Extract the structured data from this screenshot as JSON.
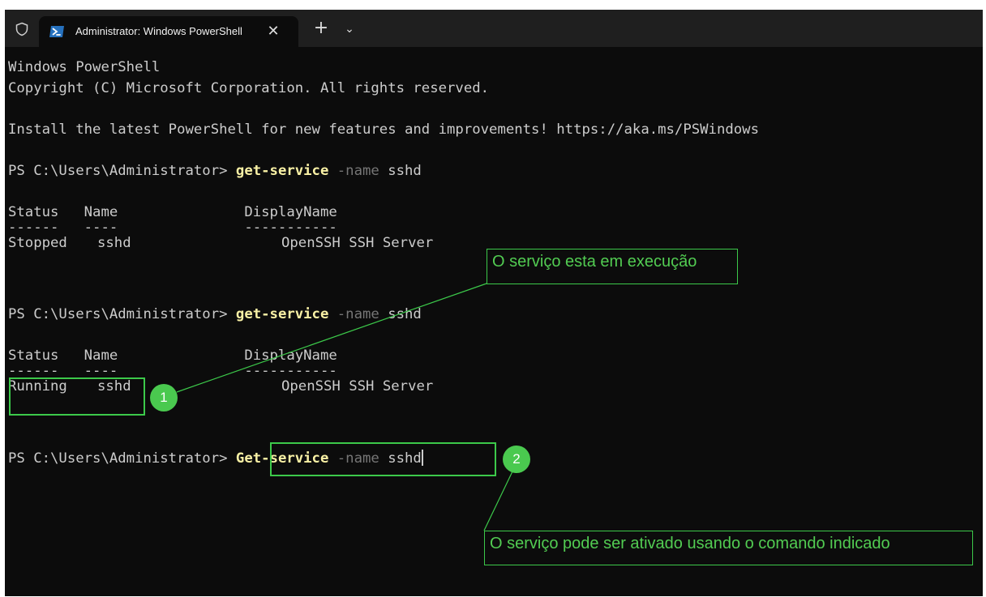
{
  "tab": {
    "title": "Administrator: Windows PowerShell",
    "close_label": "✕",
    "new_tab_label": "+",
    "dropdown_label": "⌄"
  },
  "terminal": {
    "banner": {
      "line1": "Windows PowerShell",
      "line2": "Copyright (C) Microsoft Corporation. All rights reserved.",
      "install_msg": "Install the latest PowerShell for new features and improvements! https://aka.ms/PSWindows"
    },
    "prompt": "PS C:\\Users\\Administrator> ",
    "block1": {
      "cmd": "get-service",
      "param": " -name",
      "arg": " sshd",
      "header": "Status   Name               DisplayName",
      "separator": "------   ----               -----------",
      "status": "Stopped",
      "name": "sshd",
      "display": "OpenSSH SSH Server"
    },
    "block2": {
      "cmd": "get-service",
      "param": " -name",
      "arg": " sshd",
      "header": "Status   Name               DisplayName",
      "separator": "------   ----               -----------",
      "status": "Running",
      "name": "sshd",
      "display": "OpenSSH SSH Server"
    },
    "block3": {
      "cmd": "Get-service",
      "param": " -name",
      "arg": " sshd"
    }
  },
  "annotations": {
    "badge1": "1",
    "badge2": "2",
    "callout1": "O serviço esta em execução",
    "callout2": "O serviço pode ser ativado usando o comando indicado"
  },
  "colors": {
    "terminal_bg": "#0c0c0c",
    "command": "#f9f1a5",
    "parameter": "#767676",
    "text": "#cccccc",
    "annotation_green": "#3cc94a"
  }
}
